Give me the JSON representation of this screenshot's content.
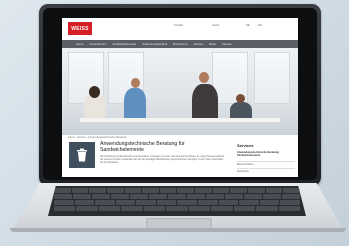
{
  "site": {
    "logo": "WEISS",
    "top_links": [
      "Kontakt",
      "Suche",
      "DE",
      "EN"
    ],
    "nav": [
      "Home",
      "Unternehmen",
      "Sandwichelemente",
      "Anwendungstechnik",
      "Referenzen",
      "Service",
      "News",
      "Karriere"
    ],
    "breadcrumb": "Home › Service › Anwendungstechnische Beratung",
    "page_title": "Anwendungstechnische Beratung für Sandwichelemente",
    "paragraph": "Die Umsetzung professioneller und innovativer Lösungen ist unser oberstes Ziel bei Weiss. In enger Zusammenarbeit mit unseren Kunden entwickeln wir auf die jeweiligen Bedürfnisse zugeschnittene Lösungen. Unser Team unterstützt Sie bei Projekten.",
    "sidebar": {
      "title": "Services",
      "active": "Anwendungstechnische Beratung Sandwichelemente",
      "items": [
        "Bauvorschriften",
        "Downloads"
      ]
    }
  },
  "colors": {
    "brand": "#d51f26",
    "nav_bg": "#5a5f66"
  },
  "icons": [
    "trash-bin-icon"
  ]
}
